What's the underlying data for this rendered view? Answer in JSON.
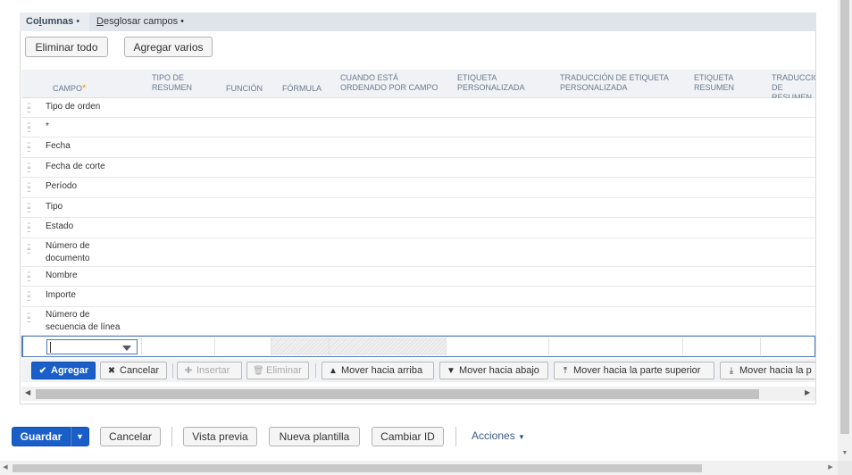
{
  "tabs": [
    {
      "label_pre": "Co",
      "label_u": "l",
      "label_post": "umnas",
      "dot": "•"
    },
    {
      "label_pre": "",
      "label_u": "D",
      "label_post": "esglosar campos",
      "dot": "•"
    }
  ],
  "toolbar": {
    "remove_all": "Eliminar todo",
    "add_multiple": "Agregar varios"
  },
  "columns": [
    "CAMPO",
    "TIPO DE RESUMEN",
    "FUNCIÓN",
    "FÓRMULA",
    "CUANDO ESTÁ ORDENADO POR CAMPO",
    "ETIQUETA PERSONALIZADA",
    "TRADUCCIÓN DE ETIQUETA PERSONALIZADA",
    "ETIQUETA RESUMEN",
    "TRADUCCIÓN DE RESUMEN"
  ],
  "required_mark": "*",
  "rows": [
    {
      "campo": "Tipo de orden"
    },
    {
      "campo": "*"
    },
    {
      "campo": "Fecha"
    },
    {
      "campo": "Fecha de corte"
    },
    {
      "campo": "Período"
    },
    {
      "campo": "Tipo"
    },
    {
      "campo": "Estado"
    },
    {
      "campo": "Número de documento"
    },
    {
      "campo": "Nombre"
    },
    {
      "campo": "Importe"
    },
    {
      "campo": "Número de secuencia de línea"
    }
  ],
  "row_actions": {
    "add": "Agregar",
    "cancel": "Cancelar",
    "insert": "Insertar",
    "delete": "Eliminar",
    "move_up": "Mover hacia arriba",
    "move_down": "Mover hacia abajo",
    "move_top": "Mover hacia la parte superior",
    "move_bottom": "Mover hacia la p"
  },
  "footer": {
    "save": "Guardar",
    "save_menu_icon": "▼",
    "cancel": "Cancelar",
    "preview": "Vista previa",
    "new_template": "Nueva plantilla",
    "change_id": "Cambiar ID",
    "actions": "Acciones"
  },
  "colors": {
    "accent": "#1a5fc9",
    "tab_bg": "#dfe4eb",
    "header_text": "#6b7a8f",
    "required": "#e6a100"
  },
  "icons": [
    "drag-handle-icon",
    "check-icon",
    "close-icon",
    "plus-icon",
    "trash-icon",
    "arrow-up-icon",
    "arrow-down-icon",
    "move-top-icon",
    "move-bottom-icon",
    "dropdown-caret-icon",
    "chevron-down-icon"
  ]
}
